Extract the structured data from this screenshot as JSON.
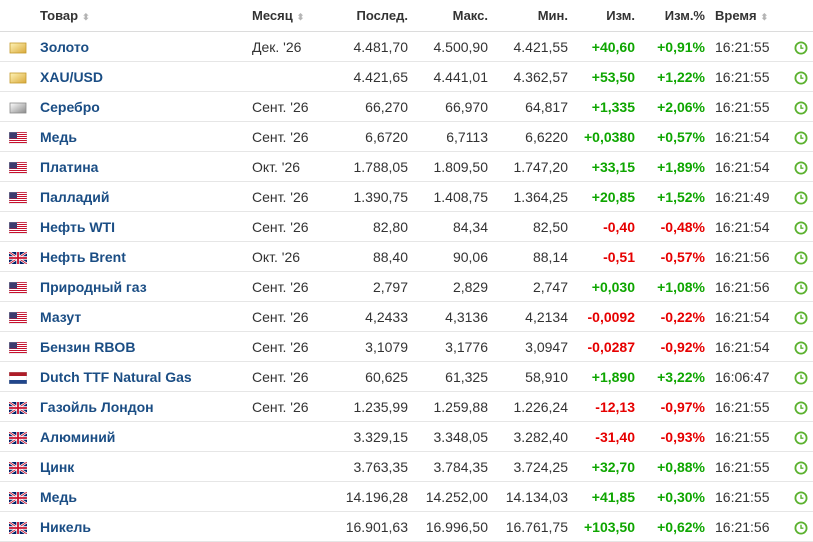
{
  "header": {
    "name": "Товар",
    "month": "Месяц",
    "last": "Послед.",
    "high": "Макс.",
    "low": "Мин.",
    "change": "Изм.",
    "change_pct": "Изм.%",
    "time": "Время"
  },
  "colors": {
    "name_link": "#1a4d84",
    "positive": "#0ea600",
    "negative": "#e60000",
    "clock_green": "#5bb12f"
  },
  "rows": [
    {
      "flag": "gold-icon",
      "name": "Золото",
      "month": "Дек. '26",
      "last": "4.481,70",
      "high": "4.500,90",
      "low": "4.421,55",
      "change": "+40,60",
      "change_pct": "+0,91%",
      "time": "16:21:55",
      "dir": "pos"
    },
    {
      "flag": "gold-icon",
      "name": "XAU/USD",
      "month": "",
      "last": "4.421,65",
      "high": "4.441,01",
      "low": "4.362,57",
      "change": "+53,50",
      "change_pct": "+1,22%",
      "time": "16:21:55",
      "dir": "pos"
    },
    {
      "flag": "silver-icon",
      "name": "Серебро",
      "month": "Сент. '26",
      "last": "66,270",
      "high": "66,970",
      "low": "64,817",
      "change": "+1,335",
      "change_pct": "+2,06%",
      "time": "16:21:55",
      "dir": "pos"
    },
    {
      "flag": "us-flag-icon",
      "name": "Медь",
      "month": "Сент. '26",
      "last": "6,6720",
      "high": "6,7113",
      "low": "6,6220",
      "change": "+0,0380",
      "change_pct": "+0,57%",
      "time": "16:21:54",
      "dir": "pos"
    },
    {
      "flag": "us-flag-icon",
      "name": "Платина",
      "month": "Окт. '26",
      "last": "1.788,05",
      "high": "1.809,50",
      "low": "1.747,20",
      "change": "+33,15",
      "change_pct": "+1,89%",
      "time": "16:21:54",
      "dir": "pos"
    },
    {
      "flag": "us-flag-icon",
      "name": "Палладий",
      "month": "Сент. '26",
      "last": "1.390,75",
      "high": "1.408,75",
      "low": "1.364,25",
      "change": "+20,85",
      "change_pct": "+1,52%",
      "time": "16:21:49",
      "dir": "pos"
    },
    {
      "flag": "us-flag-icon",
      "name": "Нефть WTI",
      "month": "Сент. '26",
      "last": "82,80",
      "high": "84,34",
      "low": "82,50",
      "change": "-0,40",
      "change_pct": "-0,48%",
      "time": "16:21:54",
      "dir": "neg"
    },
    {
      "flag": "uk-flag-icon",
      "name": "Нефть Brent",
      "month": "Окт. '26",
      "last": "88,40",
      "high": "90,06",
      "low": "88,14",
      "change": "-0,51",
      "change_pct": "-0,57%",
      "time": "16:21:56",
      "dir": "neg"
    },
    {
      "flag": "us-flag-icon",
      "name": "Природный газ",
      "month": "Сент. '26",
      "last": "2,797",
      "high": "2,829",
      "low": "2,747",
      "change": "+0,030",
      "change_pct": "+1,08%",
      "time": "16:21:56",
      "dir": "pos"
    },
    {
      "flag": "us-flag-icon",
      "name": "Мазут",
      "month": "Сент. '26",
      "last": "4,2433",
      "high": "4,3136",
      "low": "4,2134",
      "change": "-0,0092",
      "change_pct": "-0,22%",
      "time": "16:21:54",
      "dir": "neg"
    },
    {
      "flag": "us-flag-icon",
      "name": "Бензин RBOB",
      "month": "Сент. '26",
      "last": "3,1079",
      "high": "3,1776",
      "low": "3,0947",
      "change": "-0,0287",
      "change_pct": "-0,92%",
      "time": "16:21:54",
      "dir": "neg"
    },
    {
      "flag": "nl-flag-icon",
      "name": "Dutch TTF Natural Gas",
      "month": "Сент. '26",
      "last": "60,625",
      "high": "61,325",
      "low": "58,910",
      "change": "+1,890",
      "change_pct": "+3,22%",
      "time": "16:06:47",
      "dir": "pos"
    },
    {
      "flag": "uk-flag-icon",
      "name": "Газойль Лондон",
      "month": "Сент. '26",
      "last": "1.235,99",
      "high": "1.259,88",
      "low": "1.226,24",
      "change": "-12,13",
      "change_pct": "-0,97%",
      "time": "16:21:55",
      "dir": "neg"
    },
    {
      "flag": "uk-flag-icon",
      "name": "Алюминий",
      "month": "",
      "last": "3.329,15",
      "high": "3.348,05",
      "low": "3.282,40",
      "change": "-31,40",
      "change_pct": "-0,93%",
      "time": "16:21:55",
      "dir": "neg"
    },
    {
      "flag": "uk-flag-icon",
      "name": "Цинк",
      "month": "",
      "last": "3.763,35",
      "high": "3.784,35",
      "low": "3.724,25",
      "change": "+32,70",
      "change_pct": "+0,88%",
      "time": "16:21:55",
      "dir": "pos"
    },
    {
      "flag": "uk-flag-icon",
      "name": "Медь",
      "month": "",
      "last": "14.196,28",
      "high": "14.252,00",
      "low": "14.134,03",
      "change": "+41,85",
      "change_pct": "+0,30%",
      "time": "16:21:55",
      "dir": "pos"
    },
    {
      "flag": "uk-flag-icon",
      "name": "Никель",
      "month": "",
      "last": "16.901,63",
      "high": "16.996,50",
      "low": "16.761,75",
      "change": "+103,50",
      "change_pct": "+0,62%",
      "time": "16:21:56",
      "dir": "pos"
    }
  ]
}
